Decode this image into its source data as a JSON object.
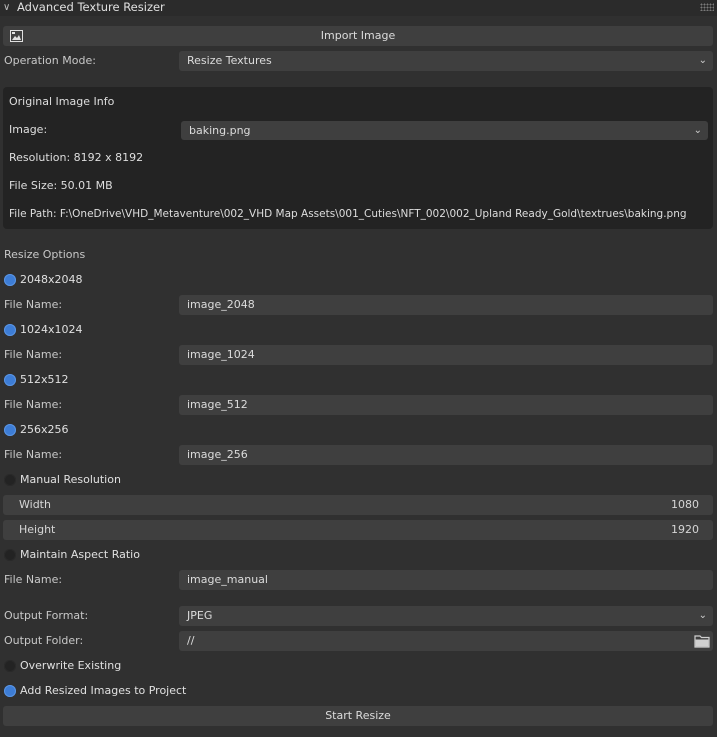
{
  "panel": {
    "title": "Advanced Texture Resizer"
  },
  "import_button": "Import Image",
  "operation_mode": {
    "label": "Operation Mode:",
    "value": "Resize Textures"
  },
  "info": {
    "heading": "Original Image Info",
    "image_label": "Image:",
    "image_value": "baking.png",
    "resolution": "Resolution: 8192 x 8192",
    "file_size": "File Size: 50.01 MB",
    "file_path": "File Path: F:\\OneDrive\\VHD_Metaventure\\002_VHD Map Assets\\001_Cuties\\NFT_002\\002_Upland Ready_Gold\\textrues\\baking.png"
  },
  "resize_options": {
    "heading": "Resize Options",
    "file_name_label": "File Name:",
    "items": [
      {
        "label": "2048x2048",
        "checked": true,
        "file_name": "image_2048"
      },
      {
        "label": "1024x1024",
        "checked": true,
        "file_name": "image_1024"
      },
      {
        "label": "512x512",
        "checked": true,
        "file_name": "image_512"
      },
      {
        "label": "256x256",
        "checked": true,
        "file_name": "image_256"
      }
    ],
    "manual": {
      "label": "Manual Resolution",
      "checked": false,
      "width_label": "Width",
      "width_value": "1080",
      "height_label": "Height",
      "height_value": "1920",
      "aspect_label": "Maintain Aspect Ratio",
      "aspect_checked": false,
      "file_name": "image_manual"
    }
  },
  "output": {
    "format_label": "Output Format:",
    "format_value": "JPEG",
    "folder_label": "Output Folder:",
    "folder_value": "//",
    "overwrite_label": "Overwrite Existing",
    "overwrite_checked": false,
    "add_to_project_label": "Add Resized Images to Project",
    "add_to_project_checked": true
  },
  "start_button": "Start Resize",
  "colors": {
    "background": "#303030",
    "field": "#3f3f3f",
    "info_box": "#232323",
    "accent": "#3d7dd6"
  }
}
